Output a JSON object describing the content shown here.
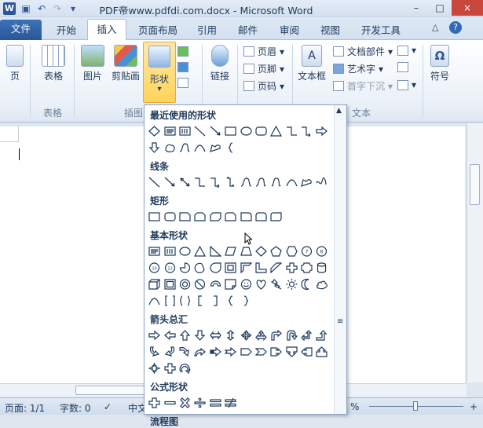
{
  "title": "PDF帝www.pdfdi.com.docx - Microsoft Word",
  "app_icon": "W",
  "window_controls": [
    "–",
    "□",
    "×"
  ],
  "tabs": {
    "file": "文件",
    "items": [
      "开始",
      "插入",
      "页面布局",
      "引用",
      "邮件",
      "审阅",
      "视图",
      "开发工具"
    ],
    "active": "插入"
  },
  "ribbon": {
    "pages": "页",
    "table": "表格",
    "picture": "图片",
    "clipart": "剪贴画",
    "shapes": "形状",
    "link": "链接",
    "header": "页眉",
    "footer": "页脚",
    "pagenum": "页码",
    "textbox": "文本框",
    "docparts": "文档部件",
    "wordart": "艺术字",
    "dropcap": "首字下沉",
    "symbol": "符号",
    "groups": {
      "table": "表格",
      "illustrations": "插图",
      "text": "文本"
    }
  },
  "gallery": {
    "sections": [
      {
        "title": "最近使用的形状",
        "rows": [
          [
            "rect-diamond",
            "textbox",
            "vtextbox",
            "line",
            "arrow-line",
            "rect",
            "ellipse",
            "round-rect",
            "triangle",
            "elbow",
            "elbow-arrow",
            "right-arrow"
          ],
          [
            "down-arrow",
            "pentagon-wave",
            "curve-arrow",
            "arc",
            "freeform",
            "brace-left"
          ]
        ]
      },
      {
        "title": "线条",
        "rows": [
          [
            "line",
            "arrow-line",
            "double-arrow",
            "elbow",
            "elbow-arrow",
            "elbow-double",
            "curve",
            "curve-arrow",
            "curve-double",
            "arc",
            "freeform",
            "scribble"
          ]
        ]
      },
      {
        "title": "矩形",
        "rows": [
          [
            "rect",
            "round-rect",
            "snip1",
            "snip2",
            "snip-diag",
            "round-snip",
            "round1",
            "round2",
            "round-diag"
          ]
        ]
      },
      {
        "title": "基本形状",
        "rows": [
          [
            "textbox",
            "vtextbox",
            "ellipse",
            "triangle",
            "right-triangle",
            "parallelogram",
            "trapezoid",
            "diamond",
            "pentagon",
            "hexagon",
            "heptagon",
            "octagon"
          ],
          [
            "decagon",
            "dodecagon",
            "pie",
            "chord",
            "teardrop",
            "frame",
            "half-frame",
            "l-shape",
            "diag-stripe",
            "plus",
            "plaque",
            "can"
          ],
          [
            "cube",
            "bevel",
            "donut",
            "no-symbol",
            "block-arc",
            "folded",
            "smiley",
            "heart",
            "lightning",
            "sun",
            "moon",
            "cloud"
          ],
          [
            "arc",
            "bracket-pair",
            "brace-pair",
            "bracket-left",
            "bracket-right",
            "brace-left",
            "brace-right"
          ]
        ]
      },
      {
        "title": "箭头总汇",
        "rows": [
          [
            "right-arrow",
            "left-arrow",
            "up-arrow",
            "down-arrow",
            "lr-arrow",
            "ud-arrow",
            "quad-arrow",
            "lr-up-arrow",
            "bent-arrow",
            "u-turn",
            "left-up",
            "bent-up"
          ],
          [
            "curved-right",
            "curved-left",
            "curved-up",
            "curved-down",
            "striped-right",
            "notched-right",
            "pentagon-arrow",
            "chevron",
            "right-callout",
            "down-callout",
            "left-callout",
            "up-callout"
          ],
          [
            "quad-callout",
            "plus-arrow",
            "circular-arrow"
          ]
        ]
      },
      {
        "title": "公式形状",
        "rows": [
          [
            "plus",
            "minus",
            "multiply",
            "divide",
            "equal",
            "not-equal"
          ]
        ]
      },
      {
        "title": "流程图",
        "rows": []
      }
    ]
  },
  "status": {
    "page": "页面: 1/1",
    "words": "字数: 0",
    "lang": "中文",
    "zoom": "%"
  }
}
